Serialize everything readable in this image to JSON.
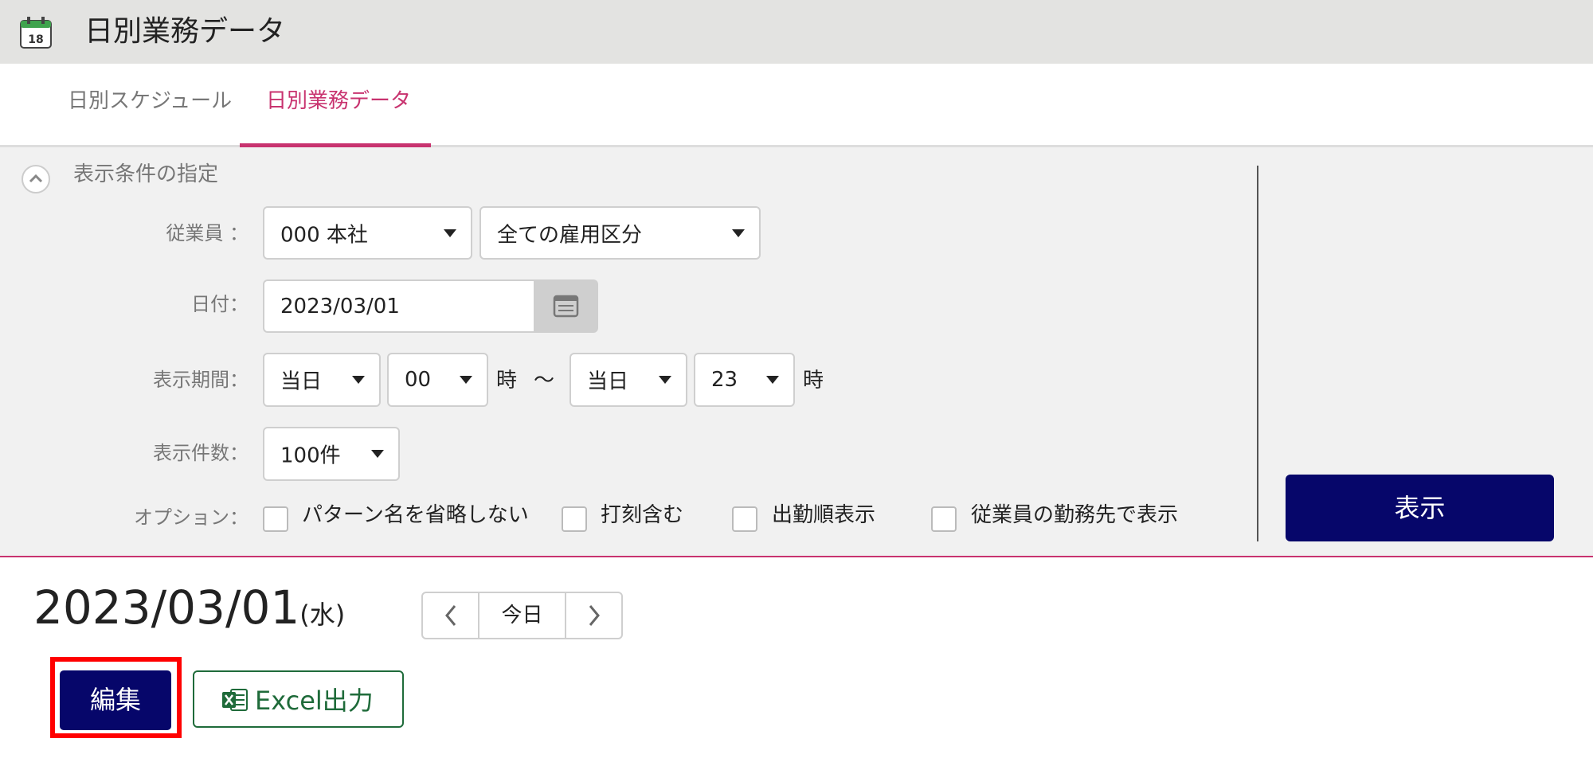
{
  "app": {
    "title": "日別業務データ"
  },
  "tabs": [
    {
      "label": "日別スケジュール",
      "active": false
    },
    {
      "label": "日別業務データ",
      "active": true
    }
  ],
  "filter": {
    "heading": "表示条件の指定",
    "employee_label": "従業員 ：",
    "employee_value": "000 本社",
    "employment_type_value": "全ての雇用区分",
    "date_label": "日付：",
    "date_value": "2023/03/01",
    "period_label": "表示期間：",
    "period_start_day": "当日",
    "period_start_hour": "00",
    "hour_unit": "時",
    "tilde": "〜",
    "period_end_day": "当日",
    "period_end_hour": "23",
    "count_label": "表示件数：",
    "count_value": "100件",
    "options_label": "オプション：",
    "options": [
      {
        "label": "パターン名を省略しない",
        "checked": false
      },
      {
        "label": "打刻含む",
        "checked": false
      },
      {
        "label": "出勤順表示",
        "checked": false
      },
      {
        "label": "従業員の勤務先で表示",
        "checked": false
      }
    ],
    "show_button": "表示"
  },
  "date_display": {
    "date": "2023/03/01",
    "weekday": "(水)"
  },
  "pager": {
    "today": "今日"
  },
  "actions": {
    "edit": "編集",
    "excel": "Excel出力"
  },
  "colors": {
    "accent": "#c8336f",
    "primary_button": "#06066a",
    "excel_green": "#1f6b3a",
    "highlight": "#ff0000"
  }
}
